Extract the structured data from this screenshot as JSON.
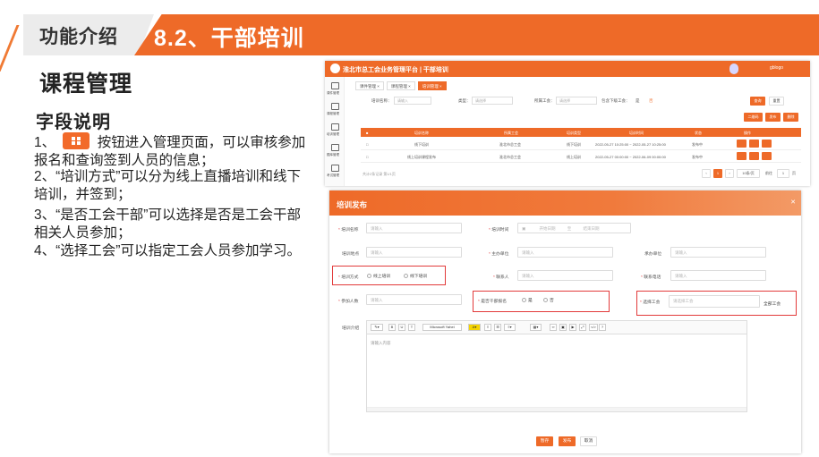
{
  "slide": {
    "section_label": "功能介绍",
    "section_title": "8.2、干部培训",
    "heading": "课程管理",
    "subheading": "字段说明",
    "p1_a": "1、",
    "p1_b": "按钮进入管理页面，可以审核参加报名和查询签到人员的信息；",
    "p2": "2、“培训方式”可以分为线上直播培训和线下培训，并签到；",
    "p3": "3、“是否工会干部”可以选择是否是工会干部相关人员参加；",
    "p4": "4、“选择工会”可以指定工会人员参加学习。",
    "accent_color": "#ee6a28",
    "highlight_color": "#e23a3a"
  },
  "list_screen": {
    "app_title": "淮北市总工会业务管理平台 | 干部培训",
    "user_name": "gblogo",
    "sidebar": [
      "课件管理",
      "课程管理",
      "培训管理",
      "题库管理",
      "考试管理"
    ],
    "tabs": [
      "课件管理 ×",
      "课程管理 ×",
      "培训管理 ×"
    ],
    "filters": {
      "name_label": "培训名称：",
      "name_placeholder": "请输入",
      "status_label": "类型：",
      "status_placeholder": "请选择",
      "union_label": "所属工会：",
      "union_placeholder": "请选择",
      "sub_label": "包含下级工会：",
      "sub_yes": "是",
      "sub_no": "否"
    },
    "buttons": {
      "search": "查询",
      "reset": "重置",
      "qrcode": "二维码",
      "publish": "发布",
      "delete": "删除"
    },
    "columns": [
      "培训名称",
      "所属工会",
      "培训类型",
      "培训时间",
      "状态",
      "操作"
    ],
    "rows": [
      {
        "name": "线下培训",
        "union": "淮北市总工会",
        "type": "线下培训",
        "time": "2022-05-27 10:25:00 ~ 2022-05-27 10:25:00",
        "status": "发布中"
      },
      {
        "name": "线上培训课程发布",
        "union": "淮北市总工会",
        "type": "线上培训",
        "time": "2022-05-27 00:00:00 ~ 2022-06-09 00:00:00",
        "status": "发布中"
      }
    ],
    "footer_text": "共计2条记录 第1/1页",
    "page_current": "1",
    "page_size": "10条/页",
    "goto_label": "前往",
    "goto_page": "1",
    "goto_unit": "页"
  },
  "form_screen": {
    "title": "培训发布",
    "fields": {
      "name_label": "培训名称",
      "name_ph": "请输入",
      "time_label": "培训时间",
      "time_start_ph": "开始日期",
      "time_sep": "至",
      "time_end_ph": "结束日期",
      "place_label": "培训地点",
      "place_ph": "请输入",
      "host_label": "主办单位",
      "host_ph": "请输入",
      "organizer_label": "承办单位",
      "organizer_ph": "请输入",
      "mode_label": "培训方式",
      "mode_online": "线上培训",
      "mode_offline": "线下培训",
      "contact_label": "联系人",
      "contact_ph": "请输入",
      "phone_label": "联系电话",
      "phone_ph": "请输入",
      "count_label": "参加人数",
      "count_ph": "请输入",
      "cadre_label": "是否干部报名",
      "cadre_yes": "是",
      "cadre_no": "否",
      "union_label": "选择工会",
      "union_ph": "请选择工会",
      "all_union": "全部工会",
      "intro_label": "培训介绍",
      "editor_font": "Microsoft Yahei",
      "editor_ph": "请输入内容"
    },
    "buttons": {
      "save": "暂存",
      "publish": "发布",
      "cancel": "取消"
    }
  }
}
